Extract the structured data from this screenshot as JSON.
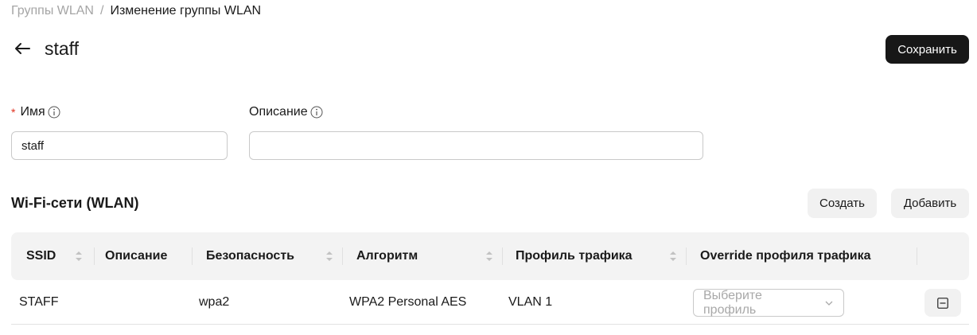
{
  "breadcrumb": {
    "parent": "Группы WLAN",
    "separator": "/",
    "current": "Изменение группы WLAN"
  },
  "header": {
    "title": "staff",
    "save_label": "Сохранить"
  },
  "form": {
    "name": {
      "label": "Имя",
      "required_mark": "*",
      "value": "staff"
    },
    "description": {
      "label": "Описание",
      "value": ""
    }
  },
  "wlan_section": {
    "title": "Wi-Fi-сети (WLAN)",
    "create_label": "Создать",
    "add_label": "Добавить"
  },
  "table": {
    "columns": [
      "SSID",
      "Описание",
      "Безопасность",
      "Алгоритм",
      "Профиль трафика",
      "Override профиля трафика"
    ],
    "rows": [
      {
        "ssid": "STAFF",
        "description": "",
        "security": "wpa2",
        "algorithm": "WPA2 Personal AES",
        "traffic_profile": "VLAN 1",
        "override_placeholder": "Выберите профиль"
      }
    ]
  },
  "colors": {
    "primary_button": "#171717",
    "required": "#e0301e",
    "muted_text": "#a5a5a5"
  },
  "icons": [
    "arrow-left-icon",
    "info-icon",
    "sort-icon",
    "chevron-down-icon",
    "remove-icon"
  ]
}
